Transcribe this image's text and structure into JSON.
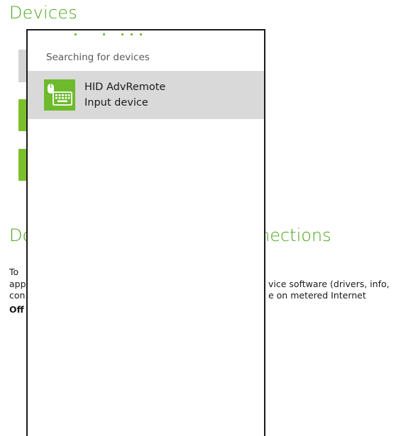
{
  "background": {
    "title": "Devices",
    "button1_label": "",
    "button2_label": "",
    "section_title": "Do nections",
    "description_lines": [
      "To vice software (drivers, info,",
      "app e on metered Internet",
      "con"
    ],
    "state": "Off"
  },
  "flyout": {
    "heading": "Searching for devices",
    "devices": [
      {
        "name": "HID AdvRemote",
        "type": "Input device",
        "icon": "keyboard-mouse-icon"
      }
    ]
  },
  "colors": {
    "accent": "#4ca41c",
    "tile": "#6dbb2c",
    "selection": "#d9d9d9"
  }
}
